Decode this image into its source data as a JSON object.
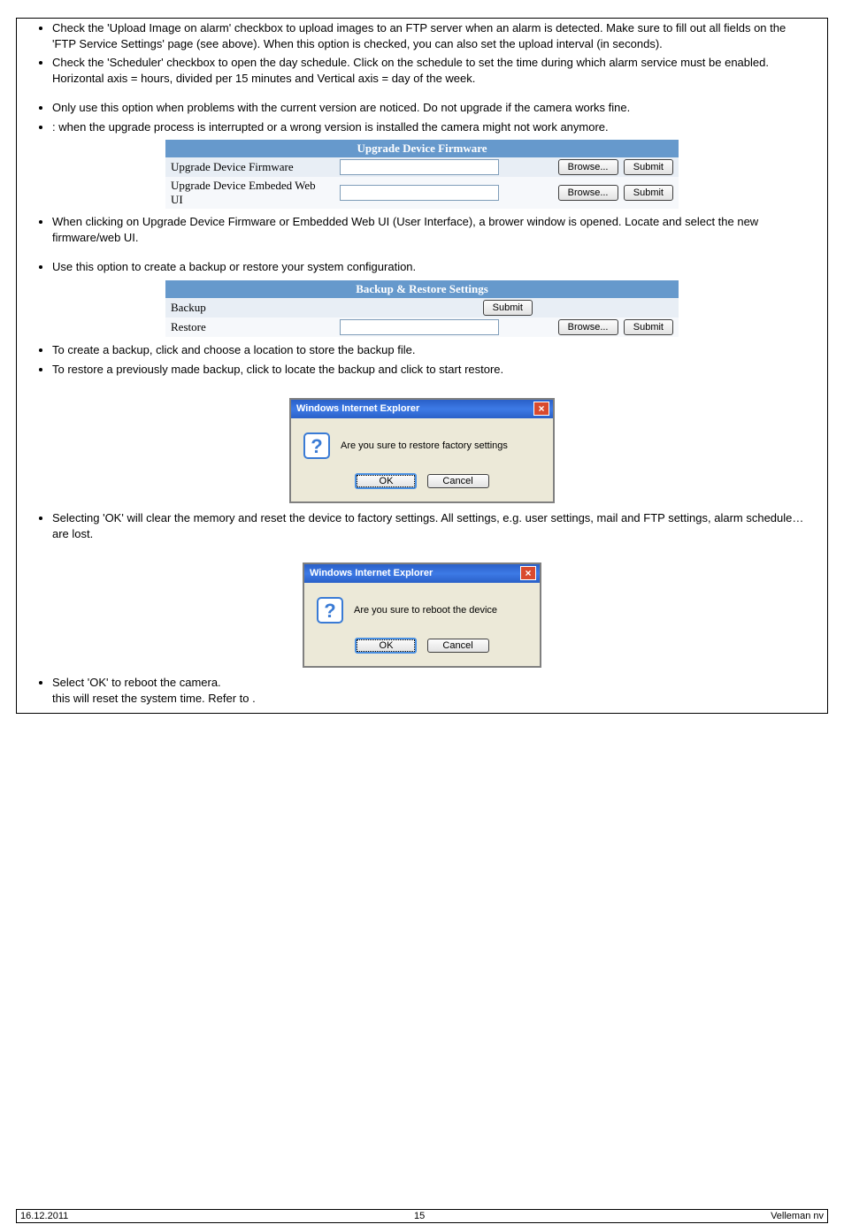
{
  "bullets_a": [
    "Check the 'Upload Image on alarm' checkbox to upload images to an FTP server when an alarm is detected. Make sure to fill out all fields on the 'FTP Service Settings' page (see above). When this option is checked, you can also set the upload interval (in seconds).",
    "Check the 'Scheduler' checkbox to open the day schedule. Click on the schedule to set the time during which alarm service must be enabled. Horizontal axis = hours, divided per 15 minutes and Vertical axis = day of the week."
  ],
  "bullets_b": [
    "Only use this option when problems with the current version are noticed. Do not upgrade if the camera works fine.",
    "         : when the upgrade process is interrupted or a wrong version is installed the camera might not work anymore."
  ],
  "upgrade_panel": {
    "title": "Upgrade Device Firmware",
    "rows": [
      {
        "label": "Upgrade Device Firmware",
        "browse": "Browse...",
        "submit": "Submit"
      },
      {
        "label": "Upgrade Device Embeded Web UI",
        "browse": "Browse...",
        "submit": "Submit"
      }
    ]
  },
  "bullets_c": [
    "When clicking on Upgrade Device Firmware or Embedded Web UI (User Interface), a brower window is opened. Locate and select the new firmware/web UI."
  ],
  "bullets_d": [
    "Use this option to create a backup or restore your system configuration."
  ],
  "backup_panel": {
    "title": "Backup & Restore Settings",
    "backup_label": "Backup",
    "restore_label": "Restore",
    "submit": "Submit",
    "browse": "Browse..."
  },
  "bullets_e": [
    "To create a backup, click           and choose a location to store the backup file.",
    "To restore a previously made backup, click              to locate the backup and click             to start restore."
  ],
  "dialog1": {
    "title": "Windows Internet Explorer",
    "msg": "Are you sure to restore factory settings",
    "ok": "OK",
    "cancel": "Cancel"
  },
  "bullets_f": [
    "Selecting 'OK' will clear the memory and reset the device to factory settings. All settings, e.g. user settings, mail and FTP settings, alarm schedule… are lost."
  ],
  "dialog2": {
    "title": "Windows Internet Explorer",
    "msg": "Are you sure to reboot the device",
    "ok": "OK",
    "cancel": "Cancel"
  },
  "bullets_g_line1": "Select 'OK' to reboot the camera.",
  "bullets_g_line2": "        this will reset the system time. Refer to                                    .",
  "footer": {
    "left": "16.12.2011",
    "mid": "15",
    "right": "Velleman nv"
  }
}
